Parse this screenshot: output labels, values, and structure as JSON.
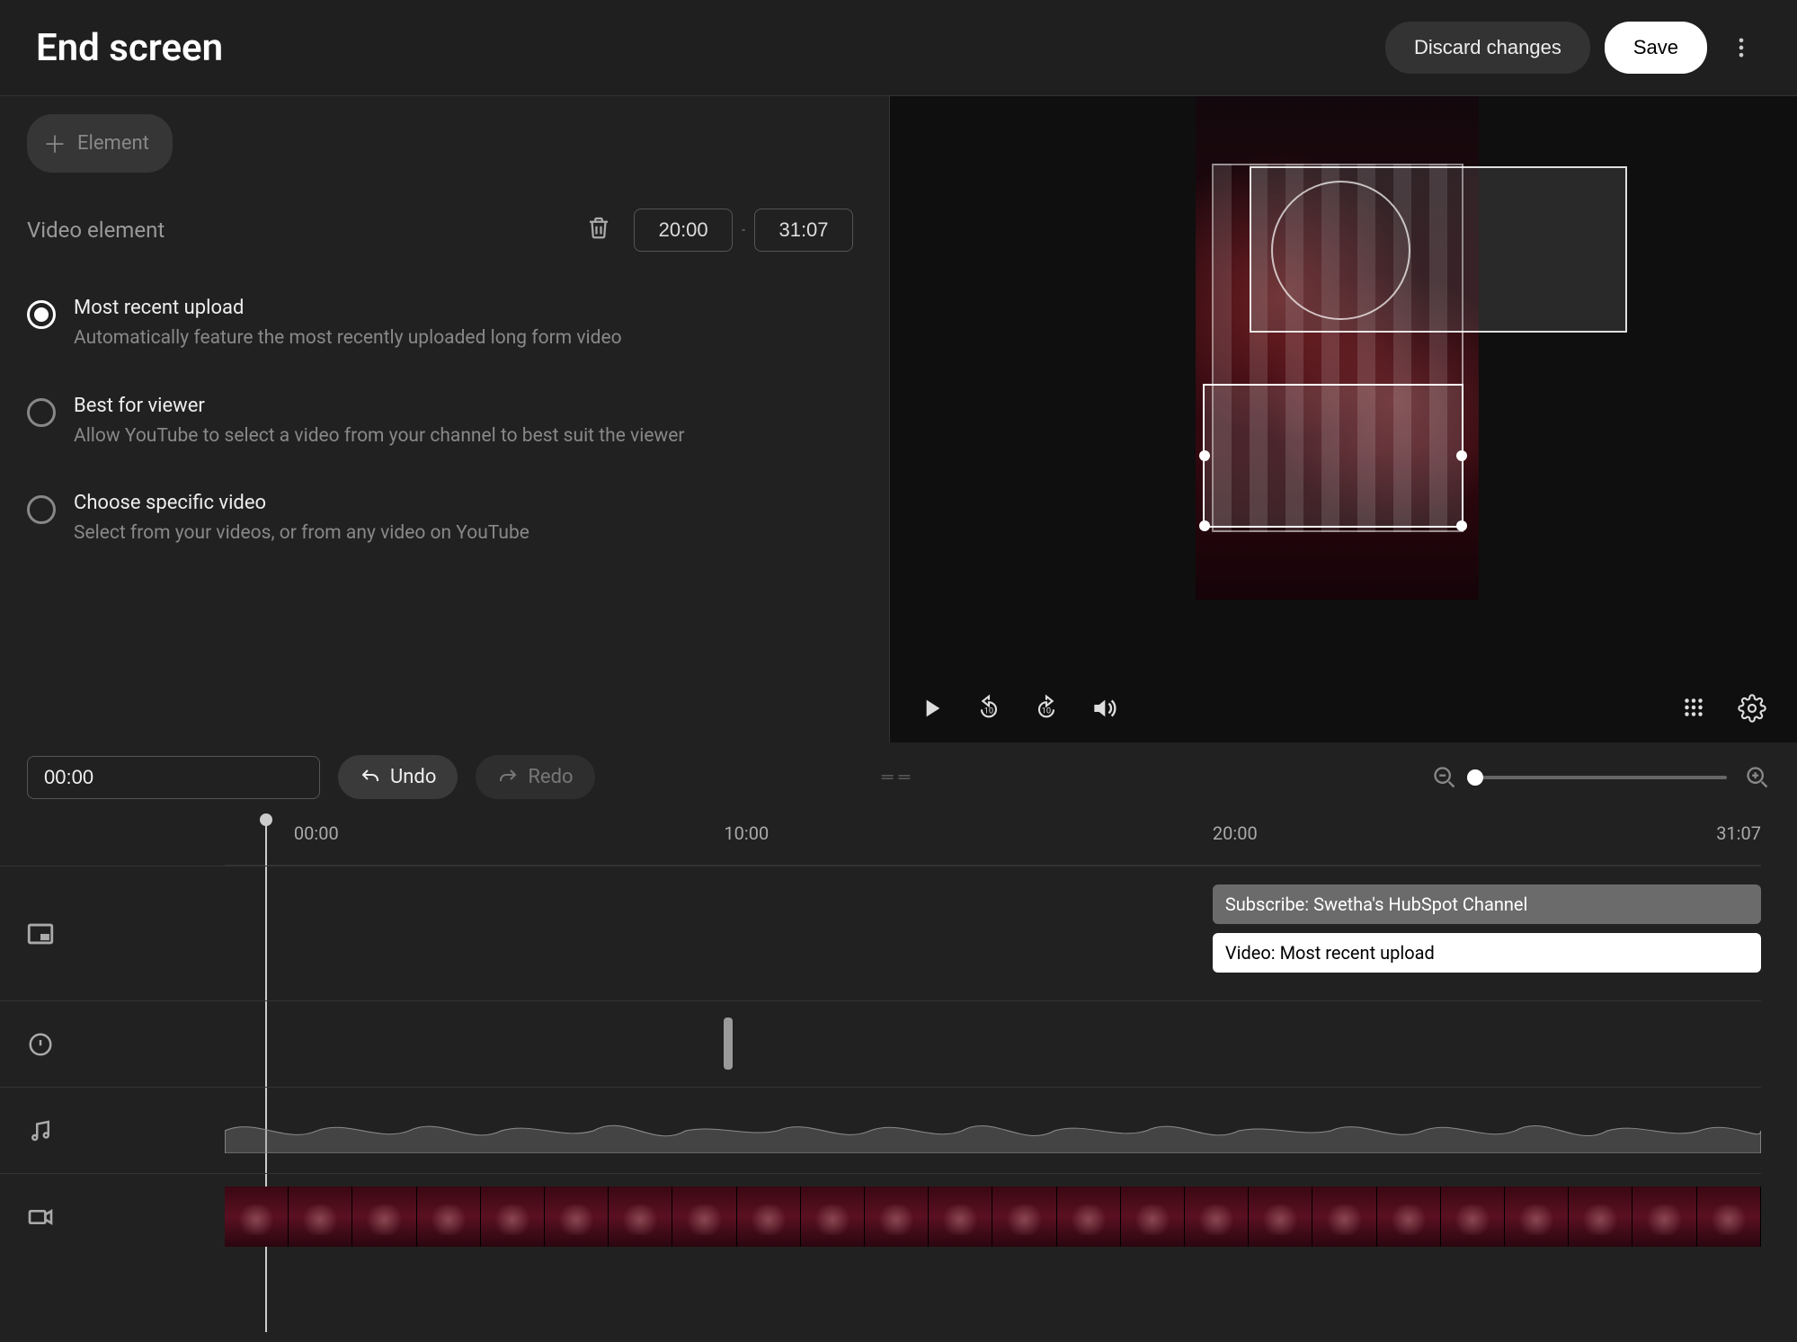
{
  "header": {
    "title": "End screen",
    "discard": "Discard changes",
    "save": "Save"
  },
  "left": {
    "add_element": "Element",
    "section_label": "Video element",
    "time_start": "20:00",
    "time_end": "31:07",
    "options": [
      {
        "title": "Most recent upload",
        "desc": "Automatically feature the most recently uploaded long form video",
        "selected": true
      },
      {
        "title": "Best for viewer",
        "desc": "Allow YouTube to select a video from your channel to best suit the viewer",
        "selected": false
      },
      {
        "title": "Choose specific video",
        "desc": "Select from your videos, or from any video on YouTube",
        "selected": false
      }
    ]
  },
  "timeline": {
    "current": "00:00",
    "undo": "Undo",
    "redo": "Redo",
    "ticks": [
      "00:00",
      "10:00",
      "20:00",
      "31:07"
    ],
    "clips": {
      "subscribe": "Subscribe: Swetha's HubSpot Channel",
      "video": "Video: Most recent upload"
    }
  }
}
